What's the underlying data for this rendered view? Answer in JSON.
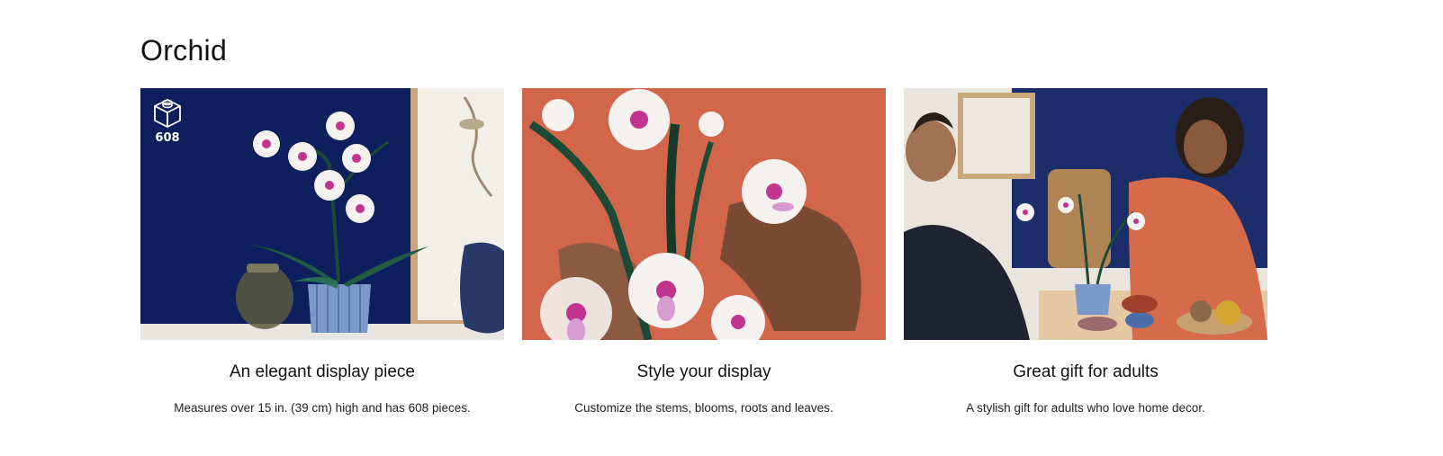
{
  "section": {
    "title": "Orchid"
  },
  "cards": [
    {
      "title": "An elegant display piece",
      "description": "Measures over 15 in. (39 cm) high and has 608 pieces.",
      "badge": {
        "icon": "brick-icon",
        "count": "608"
      }
    },
    {
      "title": "Style your display",
      "description": "Customize the stems, blooms, roots and leaves."
    },
    {
      "title": "Great gift for adults",
      "description": "A stylish gift for adults who love home decor."
    }
  ],
  "colors": {
    "navy": "#0d1f5c",
    "coral": "#d86a4f",
    "stem_green": "#1d4a36",
    "petal_white": "#f4f1ee",
    "petal_pink": "#c0338e",
    "pot_blue": "#7c97c9"
  }
}
